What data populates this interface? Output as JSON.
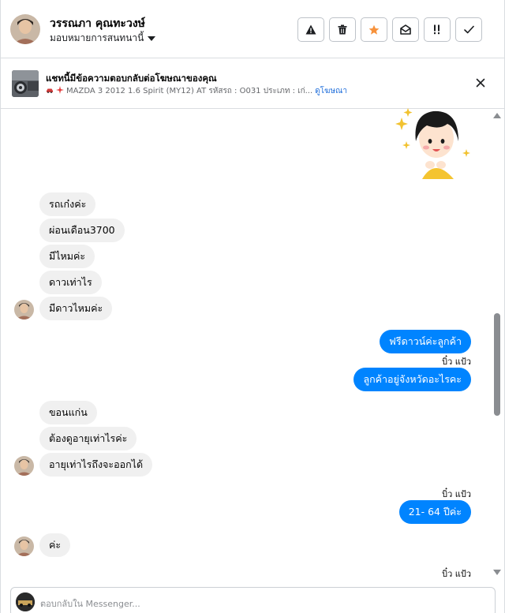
{
  "header": {
    "contact_name": "วรรณภา คุณทะวงษ์",
    "assign_label": "มอบหมายการสนทนานี้",
    "actions": [
      {
        "name": "report-spam-icon"
      },
      {
        "name": "trash-icon"
      },
      {
        "name": "star-icon"
      },
      {
        "name": "mark-unread-icon"
      },
      {
        "name": "follow-up-icon"
      },
      {
        "name": "done-check-icon"
      }
    ]
  },
  "ad": {
    "title": "แชทนี้มีข้อความตอบกลับต่อโฆษณาของคุณ",
    "subtitle": "MAZDA 3 2012 1.6 Spirit (MY12) AT รหัสรถ : O031 ประเภท : เก่...",
    "link": "ดูโฆษณา"
  },
  "messages": [
    {
      "dir": "in",
      "text": "รถเก๋งค่ะ"
    },
    {
      "dir": "in",
      "text": "ผ่อนเดือน3700"
    },
    {
      "dir": "in",
      "text": "มีไหมค่ะ"
    },
    {
      "dir": "in",
      "text": "ดาวเท่าไร"
    },
    {
      "dir": "in",
      "text": "มีดาวไหมค่ะ"
    },
    {
      "dir": "out",
      "text": "ฟรีดาวน์ค่ะลูกค้า"
    },
    {
      "dir": "out",
      "sender": "บิ๋ว แป้ว",
      "text": "ลูกค้าอยู่จังหวัดอะไรคะ"
    },
    {
      "dir": "in",
      "text": "ขอนแก่น"
    },
    {
      "dir": "in",
      "text": "ต้องดูอายุเท่าไรค่ะ"
    },
    {
      "dir": "in",
      "text": "อายุเท่าไรถึงจะออกได้"
    },
    {
      "dir": "out",
      "sender": "บิ๋ว แป้ว",
      "text": "21- 64 ปีค่ะ"
    },
    {
      "dir": "in",
      "text": "ค่ะ"
    },
    {
      "dir": "out",
      "sender": "บิ๋ว แป้ว"
    }
  ],
  "reply": {
    "placeholder": "ตอบกลับใน Messenger..."
  },
  "colors": {
    "outgoing_bubble": "#0084ff",
    "incoming_bubble": "#f0f0f0",
    "link": "#216fdb",
    "star": "#f7923b"
  }
}
